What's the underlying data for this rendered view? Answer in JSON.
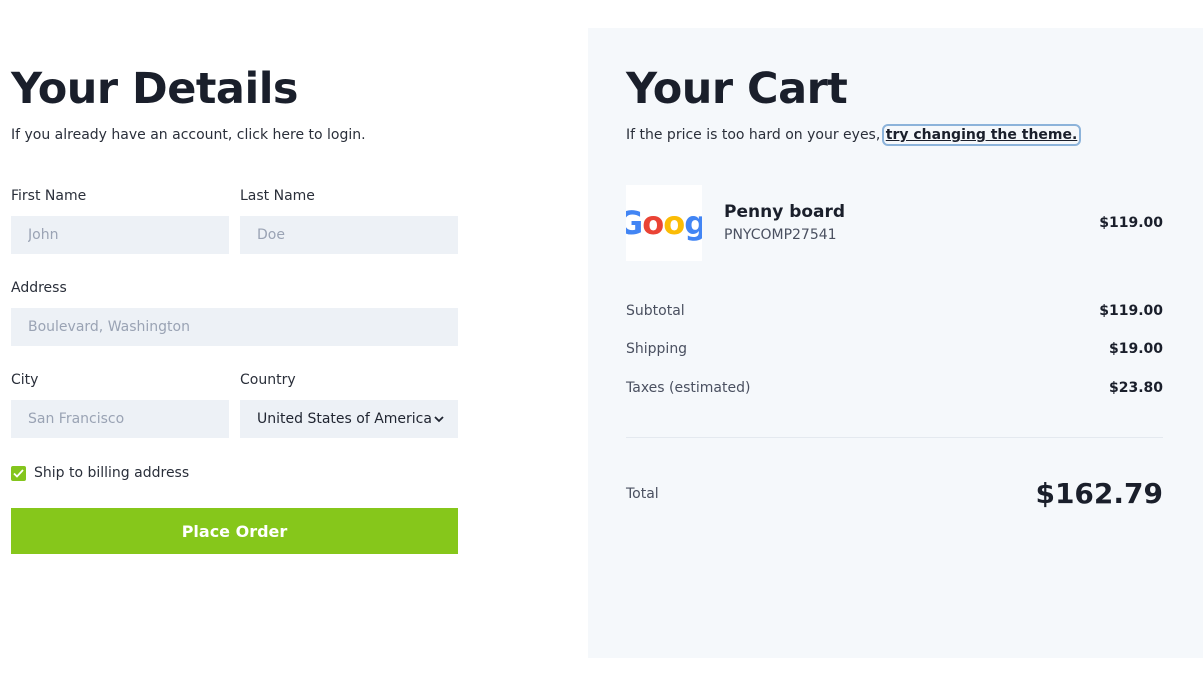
{
  "details": {
    "title": "Your Details",
    "subtitle": "If you already have an account, click here to login.",
    "first_name": {
      "label": "First Name",
      "placeholder": "John"
    },
    "last_name": {
      "label": "Last Name",
      "placeholder": "Doe"
    },
    "address": {
      "label": "Address",
      "placeholder": "Boulevard, Washington"
    },
    "city": {
      "label": "City",
      "placeholder": "San Francisco"
    },
    "country": {
      "label": "Country",
      "selected": "United States of America"
    },
    "ship_to_billing": {
      "label": "Ship to billing address",
      "checked": true
    },
    "place_order_label": "Place Order",
    "accent_color": "#86c71b"
  },
  "cart": {
    "title": "Your Cart",
    "subtitle_prefix": "If the price is too hard on your eyes, ",
    "theme_link": "try changing the theme.",
    "item": {
      "name": "Penny board",
      "sku": "PNYCOMP27541",
      "price": "$119.00",
      "thumbnail_text": "Googl"
    },
    "summary": {
      "subtotal_label": "Subtotal",
      "subtotal": "$119.00",
      "shipping_label": "Shipping",
      "shipping": "$19.00",
      "taxes_label": "Taxes (estimated)",
      "taxes": "$23.80"
    },
    "total_label": "Total",
    "total": "$162.79",
    "panel_color": "#f5f8fb"
  }
}
